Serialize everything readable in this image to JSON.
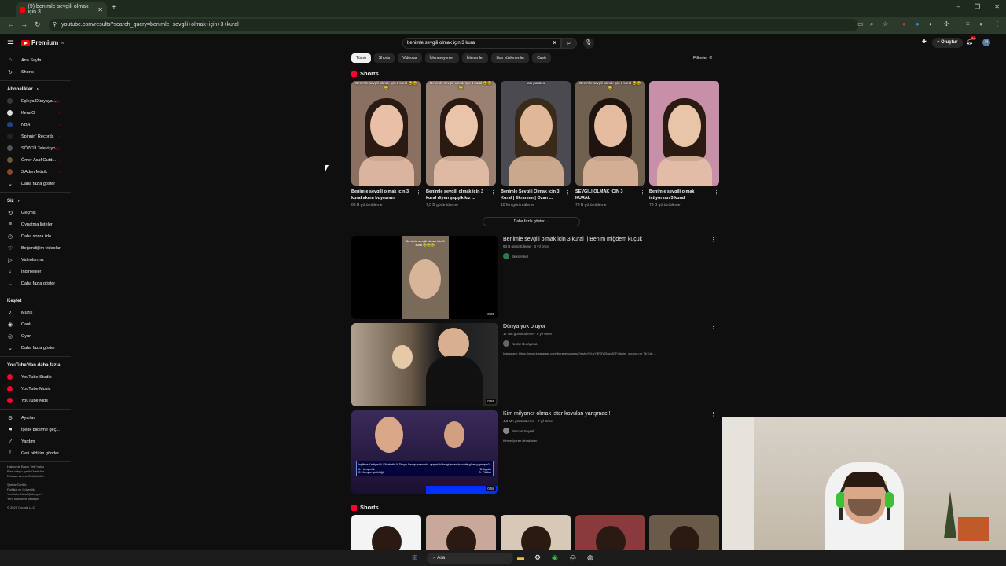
{
  "browser": {
    "tab_title": "(9) benimle sevgili olmak için 3",
    "url": "youtube.com/results?search_query=benimle+sevgili+olmak+için+3+kural"
  },
  "yt": {
    "logo": "Premium",
    "logo_sup": "TR",
    "search_value": "benimle sevgili olmak için 3 kural",
    "create_label": "Oluştur",
    "notif_count": "9+",
    "avatar_letter": "H"
  },
  "sidebar": {
    "main": [
      {
        "icon": "⌂",
        "label": "Ana Sayfa"
      },
      {
        "icon": "↻",
        "label": "Shorts"
      }
    ],
    "subs_header": "Abonelikler",
    "subs": [
      {
        "label": "Eşkıya Dünyaya ...",
        "color": "#3a3a3a",
        "live": "((•))"
      },
      {
        "label": "KeraIO",
        "color": "#ddd",
        "live": "•"
      },
      {
        "label": "NBA",
        "color": "#1d428a",
        "live": "•"
      },
      {
        "label": "Spinnin' Records",
        "color": "#222",
        "live": "•"
      },
      {
        "label": "SÖZCÜ Televizyo...",
        "color": "#555",
        "live": "((•))"
      },
      {
        "label": "Ömer Asaf Outd...",
        "color": "#6b5a3a",
        "live": "•"
      },
      {
        "label": "3 Adım Müzik",
        "color": "#8a4a2a",
        "live": "•"
      }
    ],
    "subs_more": "Daha fazla göster",
    "you_header": "Siz",
    "you": [
      {
        "icon": "⟲",
        "label": "Geçmiş"
      },
      {
        "icon": "≡",
        "label": "Oynatma listeleri"
      },
      {
        "icon": "◷",
        "label": "Daha sonra izle"
      },
      {
        "icon": "♡",
        "label": "Beğendiğim videolar"
      },
      {
        "icon": "▷",
        "label": "Videolarınız"
      },
      {
        "icon": "↓",
        "label": "İndirilenler"
      },
      {
        "icon": "⌄",
        "label": "Daha fazla göster"
      }
    ],
    "explore_header": "Keşfet",
    "explore": [
      {
        "icon": "♪",
        "label": "Müzik"
      },
      {
        "icon": "◉",
        "label": "Canlı"
      },
      {
        "icon": "◎",
        "label": "Oyun"
      },
      {
        "icon": "⌄",
        "label": "Daha fazla göster"
      }
    ],
    "more_header": "YouTube'dan daha fazla...",
    "more": [
      {
        "label": "YouTube Studio",
        "color": "#ff0033"
      },
      {
        "label": "YouTube Music",
        "color": "#ff0033"
      },
      {
        "label": "YouTube Kids",
        "color": "#ff0033"
      }
    ],
    "settings": [
      {
        "icon": "⚙",
        "label": "Ayarlar"
      },
      {
        "icon": "⚑",
        "label": "İçerik bildirme geç..."
      },
      {
        "icon": "?",
        "label": "Yardım"
      },
      {
        "icon": "!",
        "label": "Geri bildirim gönder"
      }
    ],
    "footer_lines": [
      "Hakkında Basın Telif hakkı",
      "Bize ulaşın İçerik Üreticiler",
      "Reklam verme Geliştiriciler",
      "",
      "Şartlar Gizlilik",
      "Politika ve Güvenlik",
      "YouTube Nasıl Çalışıyor?",
      "Yeni özellikleri deneyin",
      "",
      "© 2025 Google LLC"
    ]
  },
  "chips": [
    "Tümü",
    "Shorts",
    "Videolar",
    "İzlenmeyenler",
    "İzlenenler",
    "Son yüklenenler",
    "Canlı"
  ],
  "filters_label": "Filtreler",
  "shorts_title": "Shorts",
  "shorts": [
    {
      "title": "Benimle sevgili olmak için 3 kural akımı buyrunnn",
      "views": "63 B görüntüleme",
      "bg": "#8a7060",
      "skin": "#e8c0a8",
      "hair": "#2a1a12",
      "overlay": "Benimle sevgili olmak için 3 kural 😂😂😂"
    },
    {
      "title": "Benimle sevgili olmak için 3 kural diyen şapşik kız ...",
      "views": "7,5 B görüntüleme",
      "bg": "#9a8070",
      "skin": "#eac4aa",
      "hair": "#2a1a12",
      "overlay": "Benimle sevgili olmak için 3 kural 😂😂😂"
    },
    {
      "title": "Benimle Sevgili Olmak için 3 Kural | Ekranımı | Ozan ...",
      "views": "10 Mn görüntüleme",
      "bg": "#4a4a50",
      "skin": "#e0b898",
      "hair": "#3a2a1a",
      "overlay": "tatlı patates"
    },
    {
      "title": "SEVGİLİ OLMAK İÇİN 3 KURAL",
      "views": "78 B görüntüleme",
      "bg": "#706050",
      "skin": "#e4bca0",
      "hair": "#201410",
      "overlay": "Benimle sevgili olmak için 3 kural 😂😂😂"
    },
    {
      "title": "Benimle sevgili olmak istiyorsan 3 kural",
      "views": "76 B görüntüleme",
      "bg": "#c890a8",
      "skin": "#e8c4a8",
      "hair": "#2a1a12",
      "overlay": ""
    }
  ],
  "show_more_label": "Daha fazla göster",
  "videos": [
    {
      "title": "Benimle sevgili olmak için 3 kural || Benim miğdem küçük",
      "meta": "93 B görüntüleme · 3 yıl önce",
      "channel": "Beksenker",
      "channel_color": "#2a7a4a",
      "desc": "",
      "duration": "0:20",
      "bg": "#000000"
    },
    {
      "title": "Dünya yok oluyor",
      "meta": "17 Mn görüntüleme · 5 yıl önce",
      "channel": "Nuray Burayena",
      "channel_color": "#666",
      "desc": "Instagram: https://www.instagram.com/burayenanuray?igsh=NXJrY3F3Y2NwMGFn&utm_source=qr TikTok: ...",
      "duration": "0:56",
      "bg": "#8a7a6a"
    },
    {
      "title": "Kim milyoner olmak ister kovulan yarışmacı!",
      "meta": "4,3 Mn görüntüleme · 7 yıl önce",
      "channel": "Sercan Seyrek",
      "channel_color": "#888",
      "desc": "Kim milyoner olmak ister!",
      "duration": "0:58",
      "bg": "#2a1a3a"
    }
  ],
  "shorts2_title": "Shorts",
  "quiz": {
    "question": "İngiltere Kraliçesi II. Elizabeth, II. Dünya Savaşı sırasında, aşağıdaki hangi askeri kuvvette görev yapmıştır?",
    "a": "A: Hemşirelik",
    "b": "B: Aşçılık",
    "c": "C: Kamyon şoförlüğü",
    "d": "D: Pilotluk"
  },
  "taskbar": {
    "search_label": "Ara"
  }
}
